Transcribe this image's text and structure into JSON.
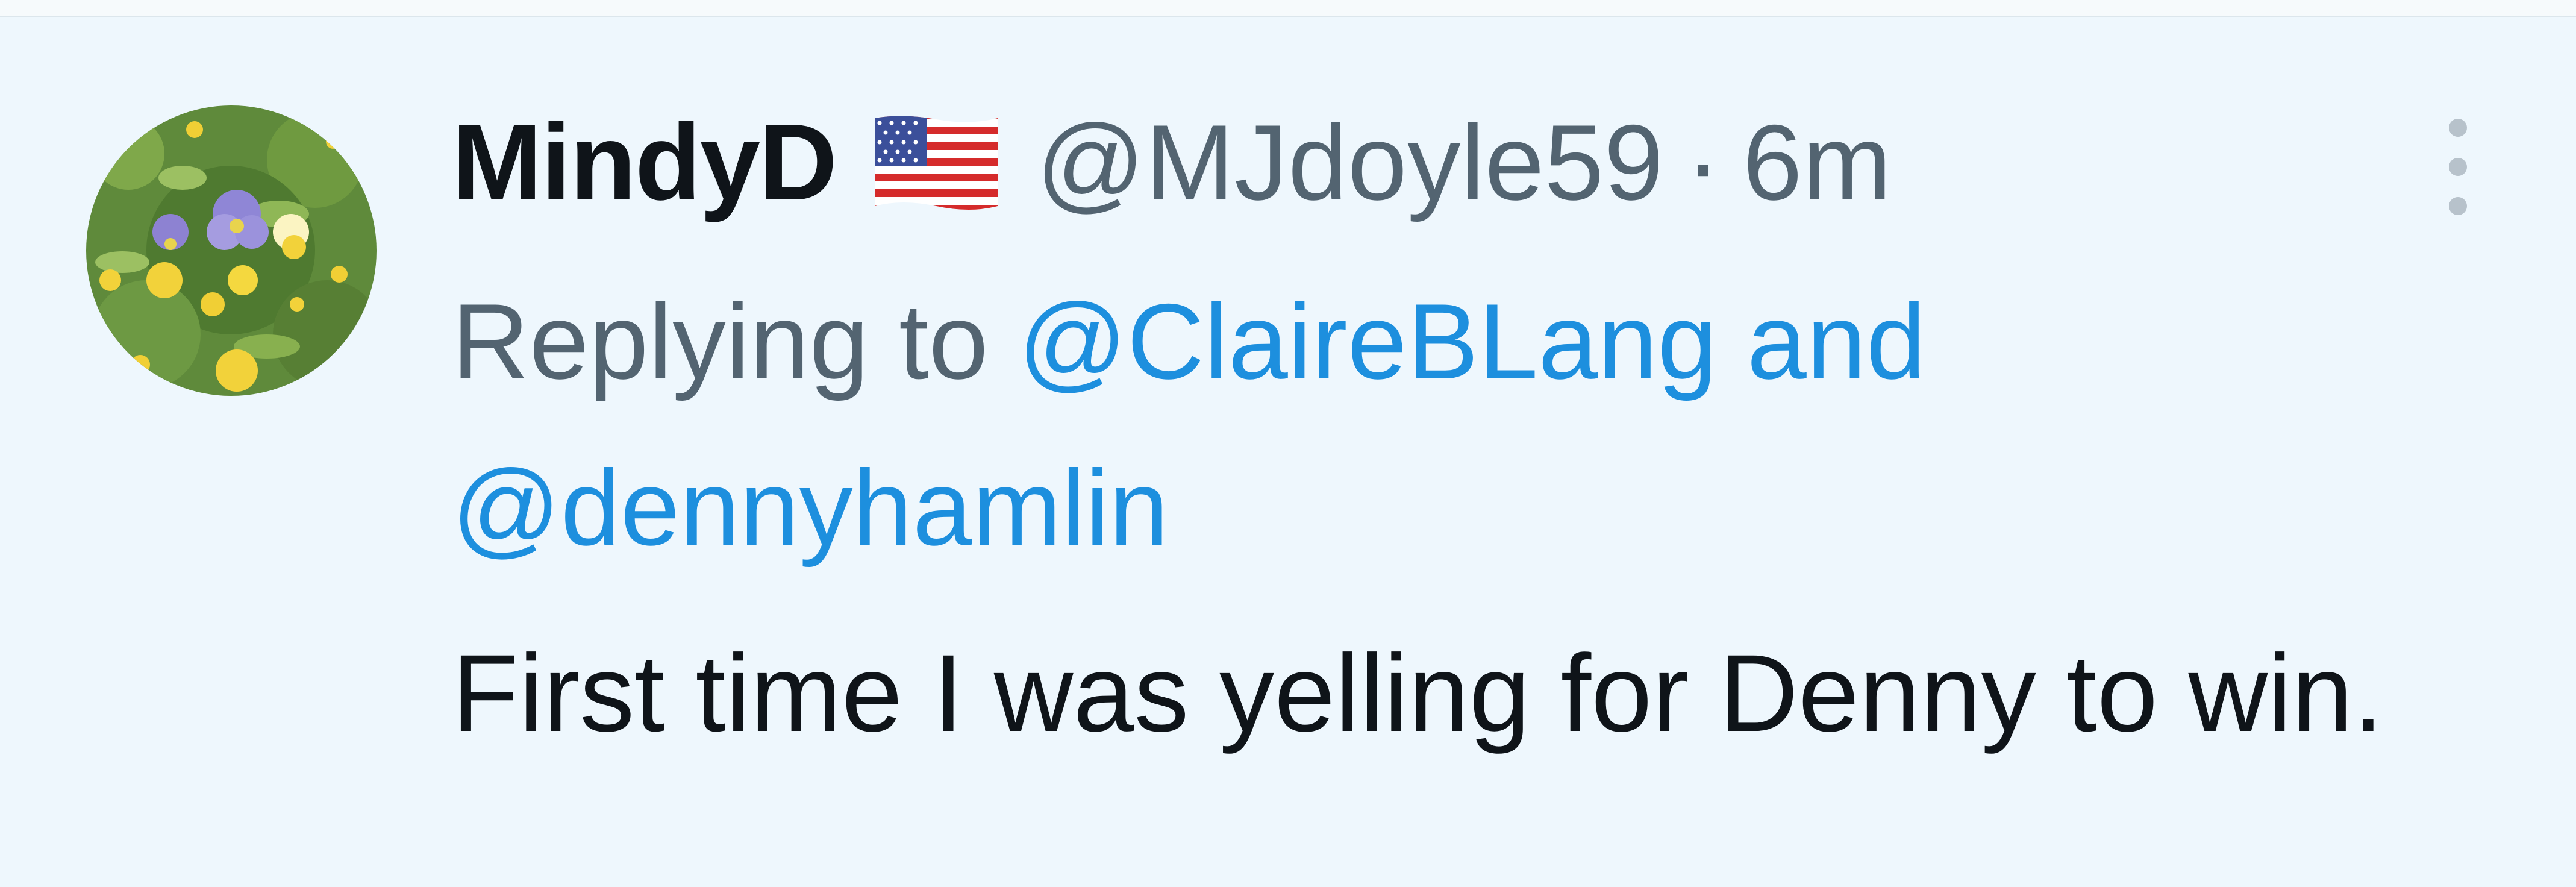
{
  "tweet": {
    "display_name": "MindyD",
    "flag_emoji": "us-flag-icon",
    "handle": "@MJdoyle59",
    "separator": "·",
    "time": "6m",
    "reply_prefix": "Replying to",
    "reply_user_1": "@ClaireBLang",
    "reply_conjunction": "and",
    "reply_user_2": "@dennyhamlin",
    "text": "First time I was yelling for Denny to win."
  },
  "colors": {
    "background": "#eef7fd",
    "text_primary": "#0f1419",
    "text_secondary": "#536471",
    "link": "#1d8fde"
  },
  "icons": {
    "avatar": "flowers-avatar-icon",
    "flag": "us-flag-icon",
    "more": "more-options-icon"
  }
}
